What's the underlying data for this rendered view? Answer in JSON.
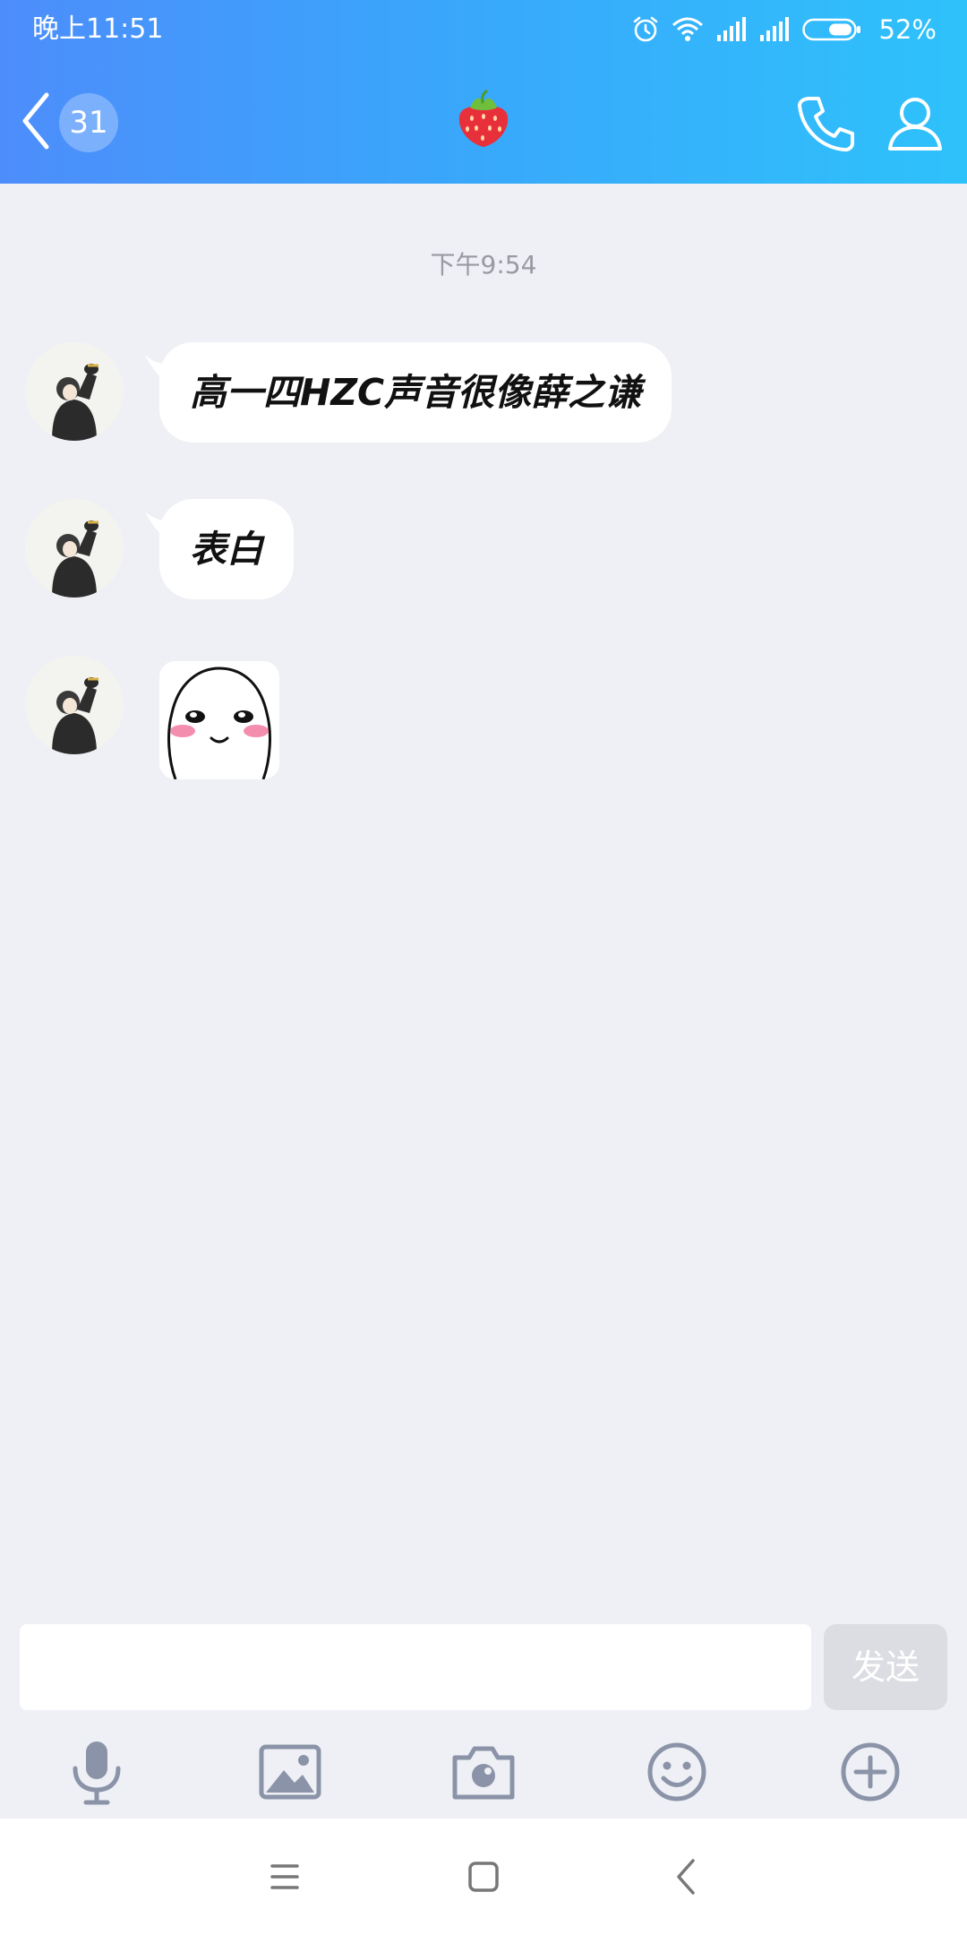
{
  "status_bar": {
    "time": "晚上11:51",
    "battery_percent": "52%",
    "icons": [
      "alarm-icon",
      "wifi-icon",
      "signal-icon",
      "signal-icon",
      "battery-icon"
    ]
  },
  "header": {
    "unread_count": "31",
    "title_emoji": "🍓",
    "icons": [
      "back-icon",
      "phone-icon",
      "profile-icon"
    ]
  },
  "chat": {
    "timestamp": "下午9:54",
    "messages": [
      {
        "type": "text",
        "text": "高一四HZC声音很像薛之谦"
      },
      {
        "type": "text",
        "text": "表白"
      },
      {
        "type": "sticker",
        "sticker": "blushing-face-sticker"
      }
    ]
  },
  "input": {
    "value": "",
    "placeholder": "",
    "send_label": "发送"
  },
  "toolbar": {
    "icons": [
      "microphone-icon",
      "image-icon",
      "camera-icon",
      "emoji-icon",
      "plus-circle-icon"
    ]
  },
  "nav_bar": {
    "icons": [
      "menu-icon",
      "home-icon",
      "back-icon"
    ]
  },
  "colors": {
    "header_gradient_start": "#4d8dfb",
    "header_gradient_end": "#2ec2fb",
    "chat_background": "#eff0f5",
    "bubble": "#ffffff",
    "timestamp": "#999aa2",
    "send_button": "#dcdde2",
    "toolbar_icon": "#8a93a8"
  }
}
